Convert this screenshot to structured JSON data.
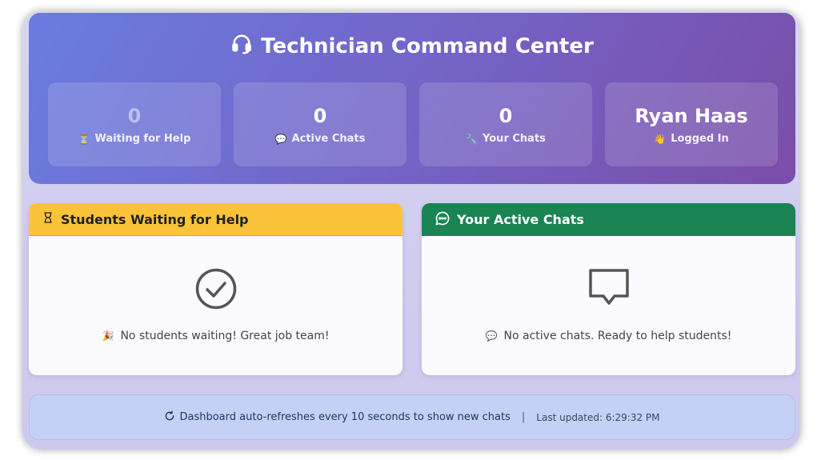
{
  "header": {
    "title": "Technician Command Center",
    "title_icon": "headset-icon"
  },
  "stats": [
    {
      "value": "0",
      "label": "Waiting for Help",
      "icon": "hourglass-icon"
    },
    {
      "value": "0",
      "label": "Active Chats",
      "icon": "speech-bubble-icon"
    },
    {
      "value": "0",
      "label": "Your Chats",
      "icon": "wrench-icon"
    },
    {
      "value": "Ryan Haas",
      "label": "Logged In",
      "icon": "waving-hand-icon"
    }
  ],
  "waiting_panel": {
    "title": "Students Waiting for Help",
    "icon": "hourglass-icon",
    "empty_icon": "check-circle-icon",
    "empty_message": "No students waiting! Great job team!",
    "empty_message_icon": "party-popper-icon",
    "accent_color": "#fbc33a"
  },
  "chats_panel": {
    "title": "Your Active Chats",
    "icon": "chat-dots-icon",
    "empty_icon": "message-square-icon",
    "empty_message": "No active chats. Ready to help students!",
    "empty_message_icon": "speech-bubble-icon",
    "accent_color": "#1a8453"
  },
  "footer": {
    "refresh_text": "Dashboard auto-refreshes every 10 seconds to show new chats",
    "separator": "|",
    "last_updated": "Last updated: 6:29:32 PM",
    "icon": "refresh-icon"
  }
}
